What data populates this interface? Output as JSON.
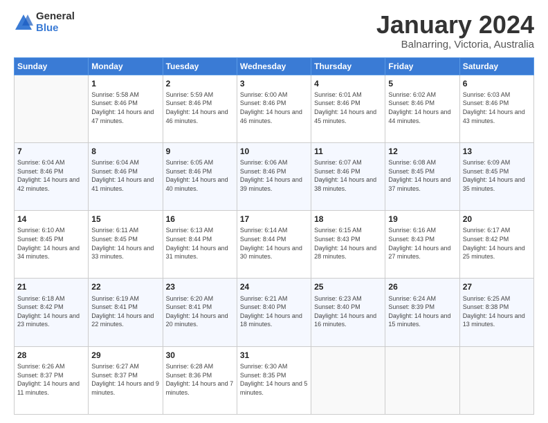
{
  "logo": {
    "general": "General",
    "blue": "Blue"
  },
  "title": "January 2024",
  "location": "Balnarring, Victoria, Australia",
  "days_header": [
    "Sunday",
    "Monday",
    "Tuesday",
    "Wednesday",
    "Thursday",
    "Friday",
    "Saturday"
  ],
  "weeks": [
    [
      {
        "day": "",
        "sunrise": "",
        "sunset": "",
        "daylight": ""
      },
      {
        "day": "1",
        "sunrise": "Sunrise: 5:58 AM",
        "sunset": "Sunset: 8:46 PM",
        "daylight": "Daylight: 14 hours and 47 minutes."
      },
      {
        "day": "2",
        "sunrise": "Sunrise: 5:59 AM",
        "sunset": "Sunset: 8:46 PM",
        "daylight": "Daylight: 14 hours and 46 minutes."
      },
      {
        "day": "3",
        "sunrise": "Sunrise: 6:00 AM",
        "sunset": "Sunset: 8:46 PM",
        "daylight": "Daylight: 14 hours and 46 minutes."
      },
      {
        "day": "4",
        "sunrise": "Sunrise: 6:01 AM",
        "sunset": "Sunset: 8:46 PM",
        "daylight": "Daylight: 14 hours and 45 minutes."
      },
      {
        "day": "5",
        "sunrise": "Sunrise: 6:02 AM",
        "sunset": "Sunset: 8:46 PM",
        "daylight": "Daylight: 14 hours and 44 minutes."
      },
      {
        "day": "6",
        "sunrise": "Sunrise: 6:03 AM",
        "sunset": "Sunset: 8:46 PM",
        "daylight": "Daylight: 14 hours and 43 minutes."
      }
    ],
    [
      {
        "day": "7",
        "sunrise": "Sunrise: 6:04 AM",
        "sunset": "Sunset: 8:46 PM",
        "daylight": "Daylight: 14 hours and 42 minutes."
      },
      {
        "day": "8",
        "sunrise": "Sunrise: 6:04 AM",
        "sunset": "Sunset: 8:46 PM",
        "daylight": "Daylight: 14 hours and 41 minutes."
      },
      {
        "day": "9",
        "sunrise": "Sunrise: 6:05 AM",
        "sunset": "Sunset: 8:46 PM",
        "daylight": "Daylight: 14 hours and 40 minutes."
      },
      {
        "day": "10",
        "sunrise": "Sunrise: 6:06 AM",
        "sunset": "Sunset: 8:46 PM",
        "daylight": "Daylight: 14 hours and 39 minutes."
      },
      {
        "day": "11",
        "sunrise": "Sunrise: 6:07 AM",
        "sunset": "Sunset: 8:46 PM",
        "daylight": "Daylight: 14 hours and 38 minutes."
      },
      {
        "day": "12",
        "sunrise": "Sunrise: 6:08 AM",
        "sunset": "Sunset: 8:45 PM",
        "daylight": "Daylight: 14 hours and 37 minutes."
      },
      {
        "day": "13",
        "sunrise": "Sunrise: 6:09 AM",
        "sunset": "Sunset: 8:45 PM",
        "daylight": "Daylight: 14 hours and 35 minutes."
      }
    ],
    [
      {
        "day": "14",
        "sunrise": "Sunrise: 6:10 AM",
        "sunset": "Sunset: 8:45 PM",
        "daylight": "Daylight: 14 hours and 34 minutes."
      },
      {
        "day": "15",
        "sunrise": "Sunrise: 6:11 AM",
        "sunset": "Sunset: 8:45 PM",
        "daylight": "Daylight: 14 hours and 33 minutes."
      },
      {
        "day": "16",
        "sunrise": "Sunrise: 6:13 AM",
        "sunset": "Sunset: 8:44 PM",
        "daylight": "Daylight: 14 hours and 31 minutes."
      },
      {
        "day": "17",
        "sunrise": "Sunrise: 6:14 AM",
        "sunset": "Sunset: 8:44 PM",
        "daylight": "Daylight: 14 hours and 30 minutes."
      },
      {
        "day": "18",
        "sunrise": "Sunrise: 6:15 AM",
        "sunset": "Sunset: 8:43 PM",
        "daylight": "Daylight: 14 hours and 28 minutes."
      },
      {
        "day": "19",
        "sunrise": "Sunrise: 6:16 AM",
        "sunset": "Sunset: 8:43 PM",
        "daylight": "Daylight: 14 hours and 27 minutes."
      },
      {
        "day": "20",
        "sunrise": "Sunrise: 6:17 AM",
        "sunset": "Sunset: 8:42 PM",
        "daylight": "Daylight: 14 hours and 25 minutes."
      }
    ],
    [
      {
        "day": "21",
        "sunrise": "Sunrise: 6:18 AM",
        "sunset": "Sunset: 8:42 PM",
        "daylight": "Daylight: 14 hours and 23 minutes."
      },
      {
        "day": "22",
        "sunrise": "Sunrise: 6:19 AM",
        "sunset": "Sunset: 8:41 PM",
        "daylight": "Daylight: 14 hours and 22 minutes."
      },
      {
        "day": "23",
        "sunrise": "Sunrise: 6:20 AM",
        "sunset": "Sunset: 8:41 PM",
        "daylight": "Daylight: 14 hours and 20 minutes."
      },
      {
        "day": "24",
        "sunrise": "Sunrise: 6:21 AM",
        "sunset": "Sunset: 8:40 PM",
        "daylight": "Daylight: 14 hours and 18 minutes."
      },
      {
        "day": "25",
        "sunrise": "Sunrise: 6:23 AM",
        "sunset": "Sunset: 8:40 PM",
        "daylight": "Daylight: 14 hours and 16 minutes."
      },
      {
        "day": "26",
        "sunrise": "Sunrise: 6:24 AM",
        "sunset": "Sunset: 8:39 PM",
        "daylight": "Daylight: 14 hours and 15 minutes."
      },
      {
        "day": "27",
        "sunrise": "Sunrise: 6:25 AM",
        "sunset": "Sunset: 8:38 PM",
        "daylight": "Daylight: 14 hours and 13 minutes."
      }
    ],
    [
      {
        "day": "28",
        "sunrise": "Sunrise: 6:26 AM",
        "sunset": "Sunset: 8:37 PM",
        "daylight": "Daylight: 14 hours and 11 minutes."
      },
      {
        "day": "29",
        "sunrise": "Sunrise: 6:27 AM",
        "sunset": "Sunset: 8:37 PM",
        "daylight": "Daylight: 14 hours and 9 minutes."
      },
      {
        "day": "30",
        "sunrise": "Sunrise: 6:28 AM",
        "sunset": "Sunset: 8:36 PM",
        "daylight": "Daylight: 14 hours and 7 minutes."
      },
      {
        "day": "31",
        "sunrise": "Sunrise: 6:30 AM",
        "sunset": "Sunset: 8:35 PM",
        "daylight": "Daylight: 14 hours and 5 minutes."
      },
      {
        "day": "",
        "sunrise": "",
        "sunset": "",
        "daylight": ""
      },
      {
        "day": "",
        "sunrise": "",
        "sunset": "",
        "daylight": ""
      },
      {
        "day": "",
        "sunrise": "",
        "sunset": "",
        "daylight": ""
      }
    ]
  ]
}
